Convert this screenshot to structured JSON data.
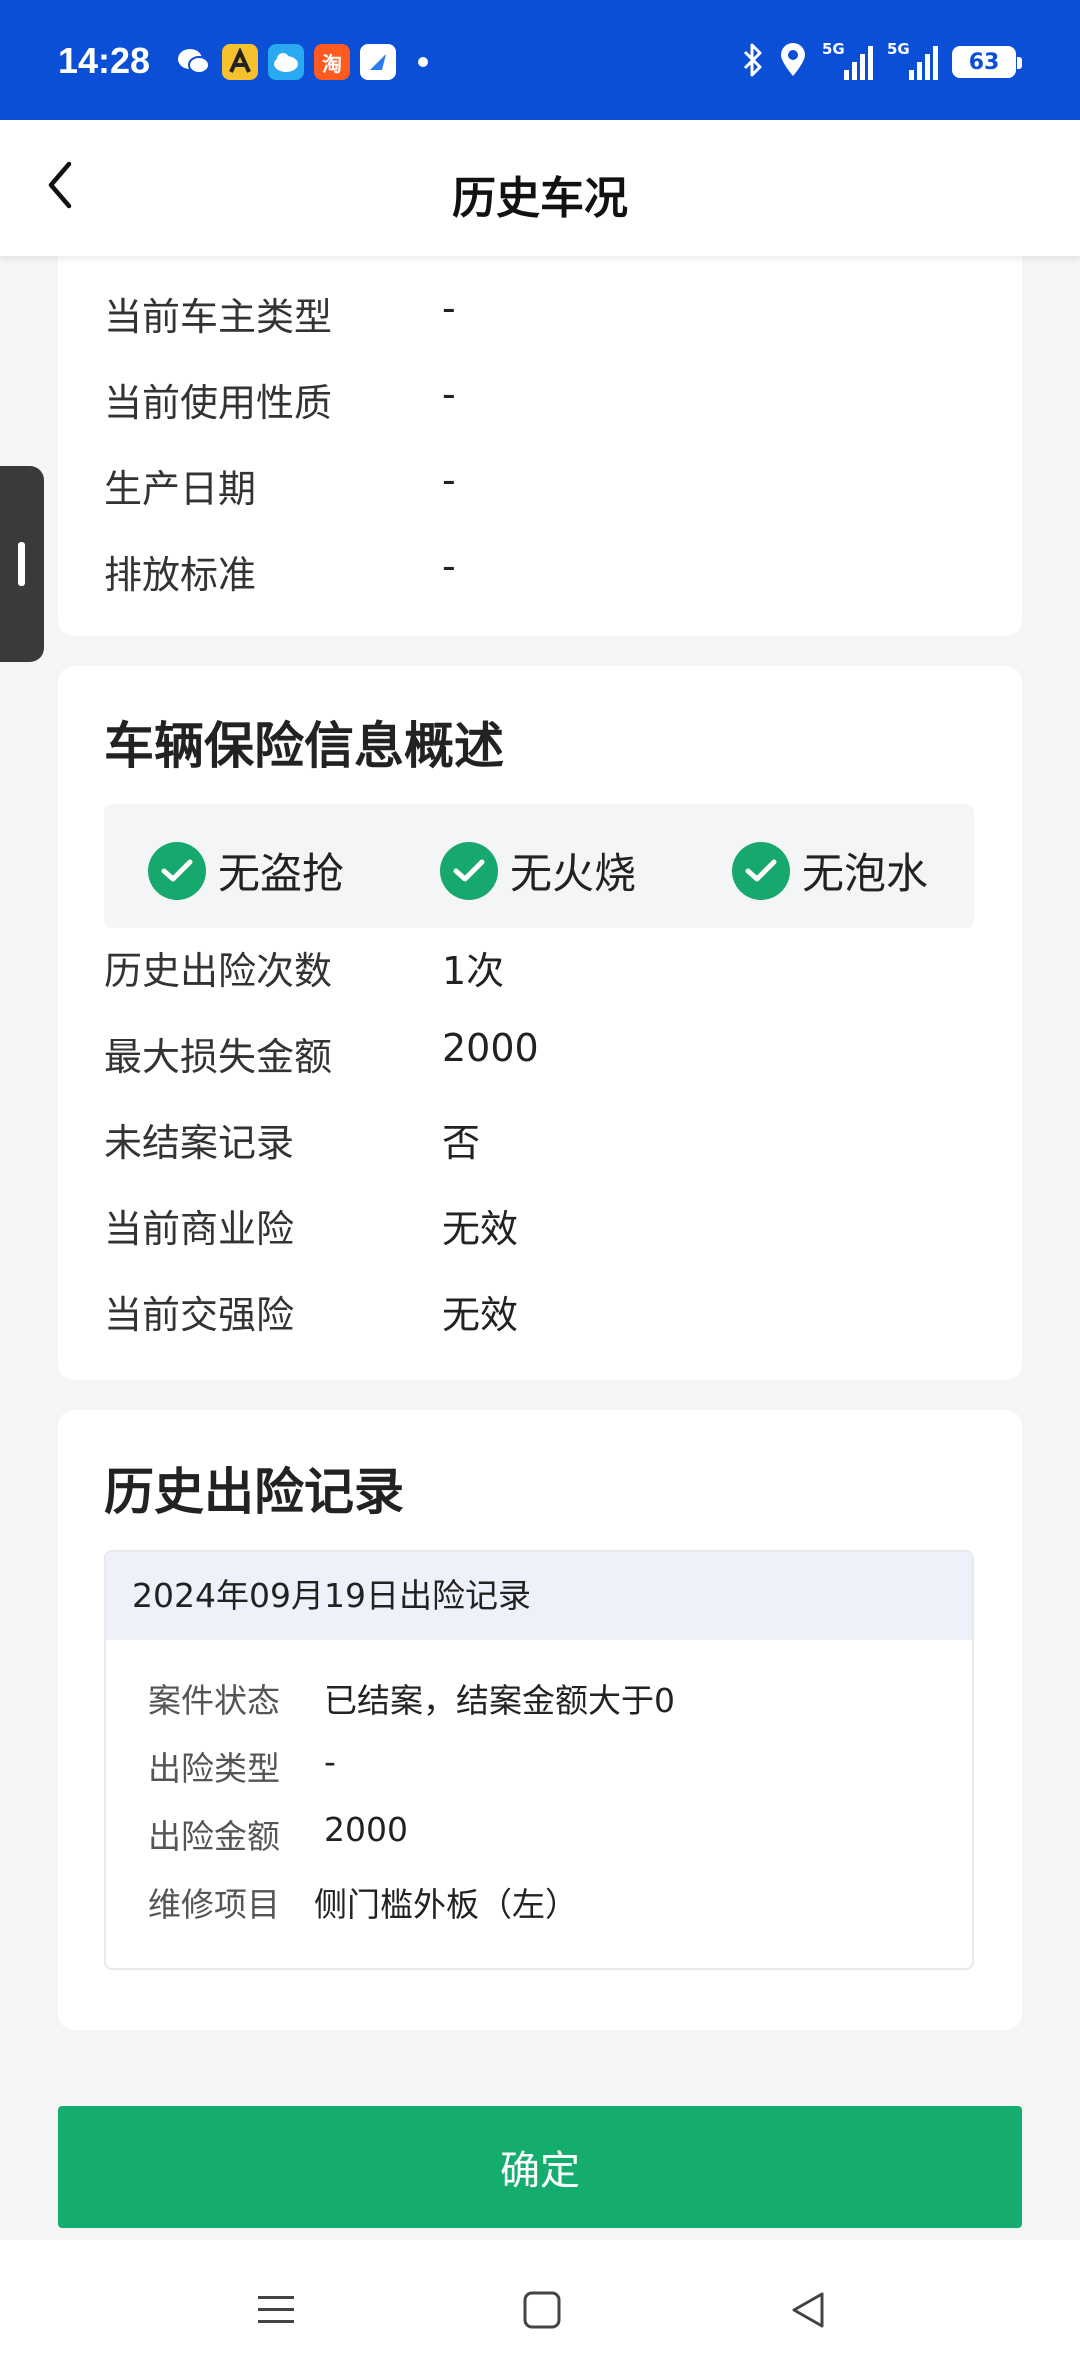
{
  "status_bar": {
    "time": "14:28",
    "app_icons": [
      "wechat-icon",
      "app-icon-a",
      "app-icon-cloud",
      "taobao-icon",
      "browser-icon"
    ],
    "taobao_label": "淘",
    "network_1": "5G",
    "network_2": "5G",
    "battery": "63",
    "colors": {
      "background": "#0b4fd6"
    }
  },
  "header": {
    "title": "历史车况",
    "back_icon": "chevron-left-icon"
  },
  "basic_info": {
    "rows": [
      {
        "label": "当前车主类型",
        "value": "-"
      },
      {
        "label": "当前使用性质",
        "value": "-"
      },
      {
        "label": "生产日期",
        "value": "-"
      },
      {
        "label": "排放标准",
        "value": "-"
      }
    ]
  },
  "insurance_summary": {
    "title": "车辆保险信息概述",
    "badges": [
      {
        "label": "无盗抢",
        "icon": "check-circle-icon"
      },
      {
        "label": "无火烧",
        "icon": "check-circle-icon"
      },
      {
        "label": "无泡水",
        "icon": "check-circle-icon"
      }
    ],
    "rows": [
      {
        "label": "历史出险次数",
        "value": "1次"
      },
      {
        "label": "最大损失金额",
        "value": "2000"
      },
      {
        "label": "未结案记录",
        "value": "否"
      },
      {
        "label": "当前商业险",
        "value": "无效"
      },
      {
        "label": "当前交强险",
        "value": "无效"
      }
    ]
  },
  "claim_history": {
    "title": "历史出险记录",
    "records": [
      {
        "heading": "2024年09月19日出险记录",
        "rows": [
          {
            "label": "案件状态",
            "value": "已结案，结案金额大于0"
          },
          {
            "label": "出险类型",
            "value": "-"
          },
          {
            "label": "出险金额",
            "value": "2000"
          },
          {
            "label": "维修项目",
            "value": "侧门槛外板（左）"
          }
        ]
      }
    ]
  },
  "confirm_button": {
    "label": "确定",
    "color": "#14ad6e"
  },
  "system_nav": {
    "icons": [
      "menu-icon",
      "home-square-icon",
      "back-triangle-icon"
    ]
  }
}
